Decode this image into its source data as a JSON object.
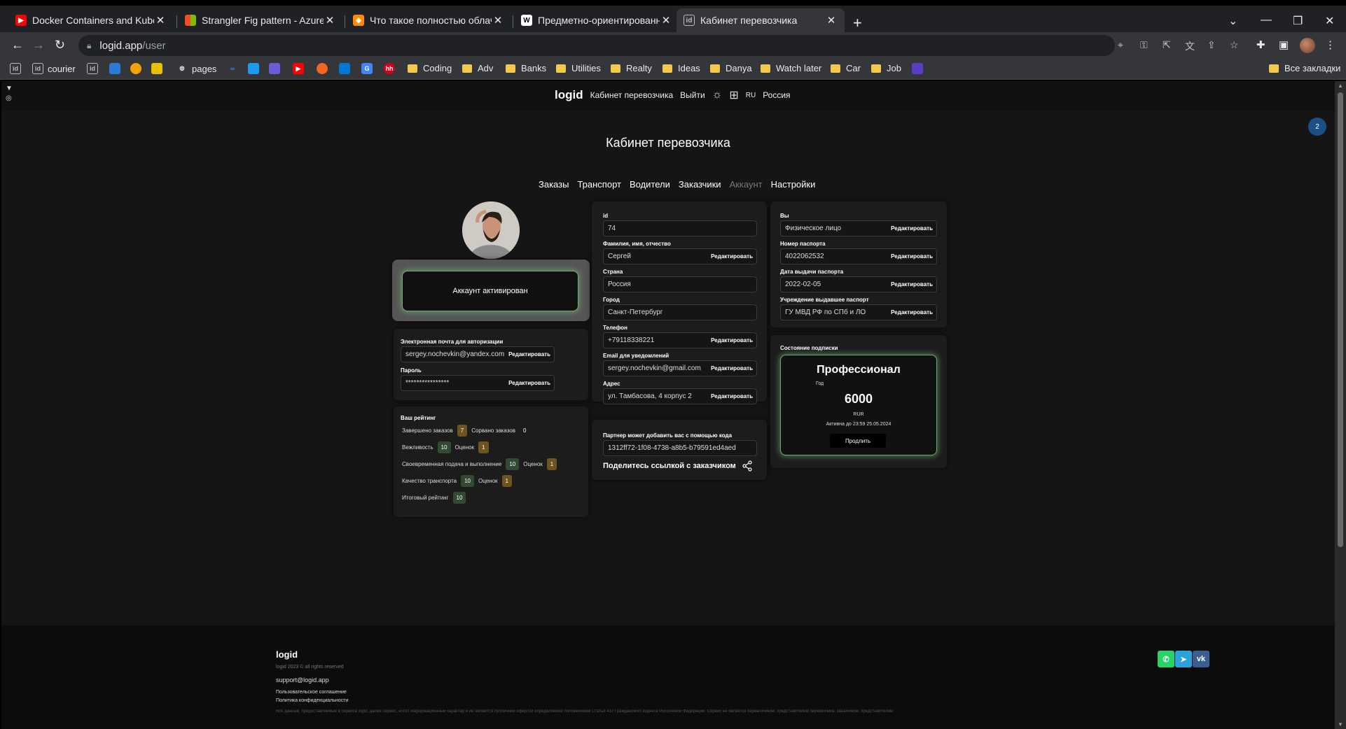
{
  "browser": {
    "tabs": [
      {
        "title": "Docker Containers and Kuberne",
        "icon": "youtube-icon",
        "color": "#ff0000"
      },
      {
        "title": "Strangler Fig pattern - Azure Arc",
        "icon": "microsoft-icon",
        "color": "#f25022"
      },
      {
        "title": "Что такое полностью облачна",
        "icon": "cube-icon",
        "color": "#ff8c00"
      },
      {
        "title": "Предметно-ориентированное",
        "icon": "wikipedia-icon",
        "color": "#ffffff"
      },
      {
        "title": "Кабинет перевозчика",
        "icon": "logid-icon",
        "color": "#bbbbbb"
      }
    ],
    "address": {
      "host": "logid.app",
      "path": "/user"
    },
    "bookmarks": {
      "courier": "courier",
      "pages": "pages",
      "folders": [
        "Coding",
        "Adv",
        "Banks",
        "Utilities",
        "Realty",
        "Ideas",
        "Danya",
        "Watch later",
        "Car",
        "Job"
      ],
      "all_bookmarks": "Все закладки"
    }
  },
  "site": {
    "logo": "logid",
    "nav": {
      "cabinet": "Кабинет перевозчика",
      "logout": "Выйти",
      "lang": "RU",
      "country": "Россия"
    },
    "notifications": "2",
    "page_title": "Кабинет перевозчика",
    "tabs": [
      "Заказы",
      "Транспорт",
      "Водители",
      "Заказчики",
      "Аккаунт",
      "Настройки"
    ],
    "active_tab": "Аккаунт"
  },
  "account": {
    "activation": "Аккаунт активирован",
    "email_label": "Электронная почта для авторизации",
    "email": "sergey.nochevkin@yandex.com",
    "password_label": "Пароль",
    "password": "****************",
    "edit": "Редактировать"
  },
  "rating": {
    "title": "Ваш рейтинг",
    "completed_label": "Завершено заказов",
    "completed": "7",
    "failed_label": "Сорвано заказов",
    "failed": "0",
    "politeness_label": "Вежливость",
    "politeness": "10",
    "timeliness_label": "Своевременная подача и выполнение",
    "timeliness": "10",
    "transport_label": "Качество транспорта",
    "transport": "10",
    "ratings_label": "Оценок",
    "ratings_count": "1",
    "total_label": "Итоговый рейтинг",
    "total": "10"
  },
  "profile": {
    "id_label": "id",
    "id": "74",
    "name_label": "Фамилия, имя, отчество",
    "name": "Сергей",
    "country_label": "Страна",
    "country": "Россия",
    "city_label": "Город",
    "city": "Санкт-Петербург",
    "phone_label": "Телефон",
    "phone": "+79118338221",
    "notify_email_label": "Email для уведомлений",
    "notify_email": "sergey.nochevkin@gmail.com",
    "address_label": "Адрес",
    "address": "ул. Тамбасова, 4 корпус 2"
  },
  "partner": {
    "label": "Партнер может добавить вас с помощью кода",
    "code": "1312ff72-1f08-4738-a8b5-b79591ed4aed",
    "share": "Поделитесь ссылкой с заказчиком"
  },
  "legal": {
    "you_label": "Вы",
    "you": "Физическое лицо",
    "passport_label": "Номер паспорта",
    "passport": "4022062532",
    "issue_date_label": "Дата выдачи паспорта",
    "issue_date": "2022-02-05",
    "issuer_label": "Учреждение выдавшее паспорт",
    "issuer": "ГУ МВД РФ по СПб и ЛО"
  },
  "subscription": {
    "label": "Состояние подписки",
    "plan": "Профессионал",
    "period": "Год",
    "price": "6000",
    "currency": "RUR",
    "active_until": "Активна до 23:59 25.05.2024",
    "renew": "Продлить"
  },
  "footer": {
    "logo": "logid",
    "copyright": "logid 2023 © all rights reserved",
    "email": "support@logid.app",
    "terms": "Пользовательское соглашение",
    "privacy": "Политика конфиденциальности",
    "disclaimer": "Все данные, предоставляемые в сервисе logid, далее сервис, носят информационный характер и не являются публичной офертой определяемой положениями Статьи 437 Гражданского кодекса Российской Федерации. Сервис не является перевозчиком, представителем перевозчика, заказчиком, представителем",
    "socials": [
      "whatsapp-icon",
      "telegram-icon",
      "vk-icon"
    ]
  },
  "colors": {
    "accent_green": "#6fa56f",
    "badge_blue": "#1c4f86",
    "rating_green": "#324a32",
    "rating_brown": "#6e5420"
  }
}
